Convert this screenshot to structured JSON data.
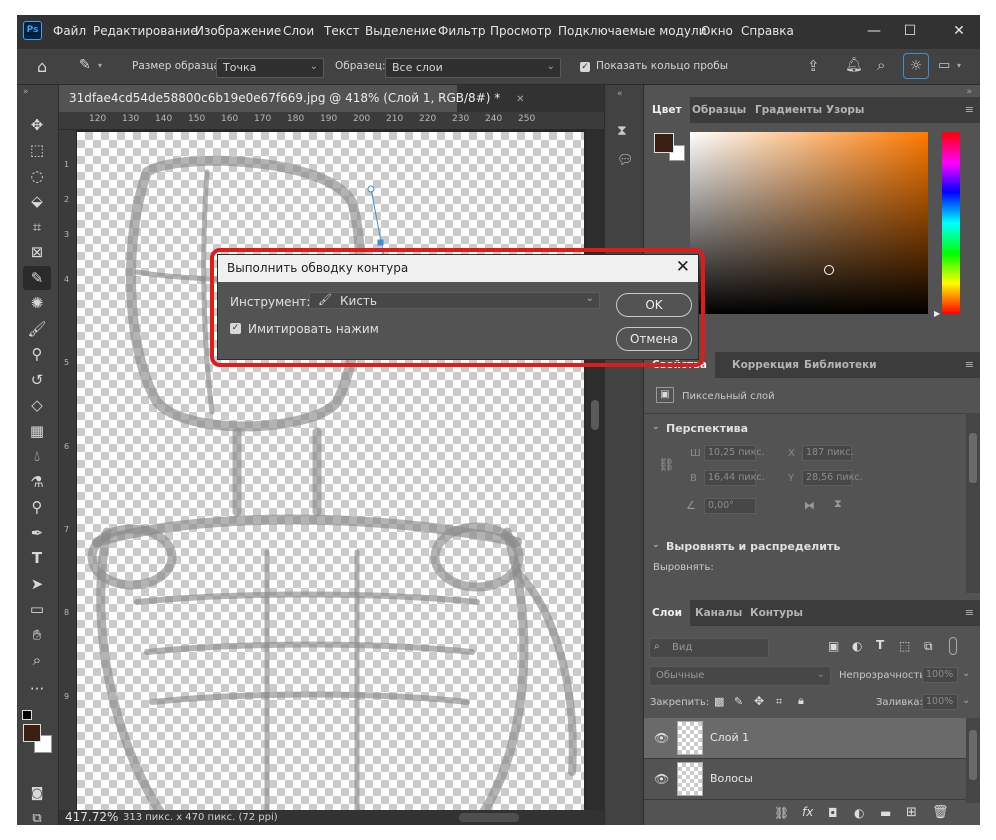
{
  "app": {
    "logo": "Ps"
  },
  "menu": [
    "Файл",
    "Редактирование",
    "Изображение",
    "Слои",
    "Текст",
    "Выделение",
    "Фильтр",
    "Просмотр",
    "Подключаемые модули",
    "Окно",
    "Справка"
  ],
  "window_controls": {
    "minimize": "—",
    "maximize": "☐",
    "close": "✕"
  },
  "options": {
    "sample_size_label": "Размер образца:",
    "sample_size_value": "Точка",
    "sample_label": "Образец:",
    "sample_value": "Все слои",
    "show_ring_label": "Показать кольцо пробы"
  },
  "document": {
    "tab_title": "31dfae4cd54de58800c6b19e0e67f669.jpg @ 418% (Слой 1, RGB/8#) *",
    "tab_close": "✕",
    "ruler_h": [
      "120",
      "130",
      "140",
      "150",
      "160",
      "170",
      "180",
      "190",
      "200",
      "210",
      "220",
      "230",
      "240",
      "250"
    ],
    "ruler_v": [
      "1",
      "2",
      "3",
      "4",
      "5",
      "6",
      "7",
      "8",
      "9"
    ],
    "zoom": "417.72%",
    "size_info": "313 пикс. x 470 пикс. (72 ppi)"
  },
  "dialog": {
    "title": "Выполнить обводку контура",
    "tool_label": "Инструмент:",
    "tool_value": "Кисть",
    "simulate_label": "Имитировать нажим",
    "ok": "OK",
    "cancel": "Отмена"
  },
  "color_panel": {
    "tabs": [
      "Цвет",
      "Образцы",
      "Градиенты",
      "Узоры"
    ],
    "foreground": "#3a2010",
    "background": "#ffffff"
  },
  "props_panel": {
    "tabs": [
      "Свойства",
      "Коррекция",
      "Библиотеки"
    ],
    "layer_type": "Пиксельный слой",
    "perspective": "Перспектива",
    "w_label": "Ш",
    "w_value": "10,25 пикс.",
    "x_label": "X",
    "x_value": "187 пикс.",
    "h_label": "В",
    "h_value": "16,44 пикс.",
    "y_label": "Y",
    "y_value": "28,56 пикс.",
    "angle_value": "0,00°",
    "align_section": "Выровнять и распределить",
    "align_label": "Выровнять:"
  },
  "layers_panel": {
    "tabs": [
      "Слои",
      "Каналы",
      "Контуры"
    ],
    "search_placeholder": "Вид",
    "blend_mode": "Обычные",
    "opacity_label": "Непрозрачность:",
    "opacity_value": "100%",
    "lock_label": "Закрепить:",
    "fill_label": "Заливка:",
    "fill_value": "100%",
    "layers": [
      "Слой 1",
      "Волосы"
    ]
  }
}
